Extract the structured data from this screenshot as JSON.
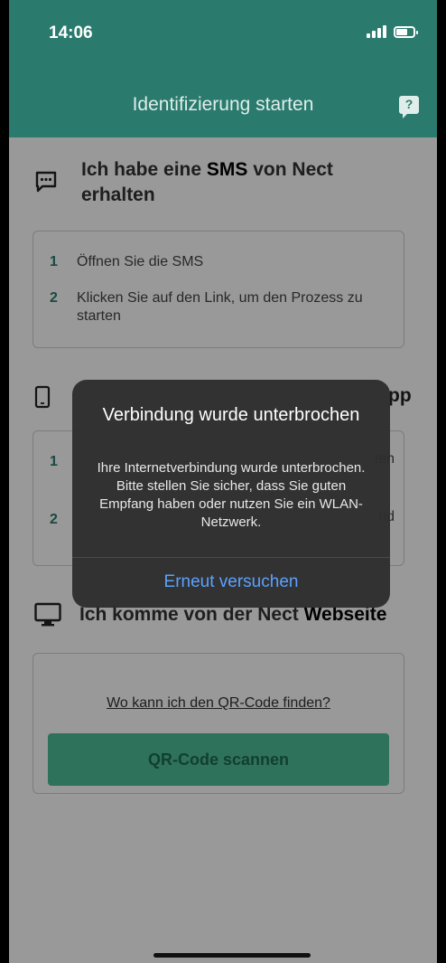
{
  "status_bar": {
    "time": "14:06"
  },
  "header": {
    "title": "Identifizierung starten",
    "help_label": "?"
  },
  "sms_section": {
    "title_prefix": "Ich habe eine ",
    "title_bold": "SMS",
    "title_suffix": " von Nect erhalten",
    "steps": [
      {
        "num": "1",
        "text": "Öffnen Sie die SMS"
      },
      {
        "num": "2",
        "text": "Klicken Sie auf den Link, um den Prozess zu starten"
      }
    ]
  },
  "app_section": {
    "title_end": "pp",
    "steps": [
      {
        "num": "1",
        "tail": "ten"
      },
      {
        "num": "2",
        "tail": "nd"
      }
    ]
  },
  "web_section": {
    "title_prefix": "Ich komme von der Nect ",
    "title_bold": "Webseite",
    "link": "Wo kann ich den QR-Code finden?",
    "button": "QR-Code scannen"
  },
  "alert": {
    "title": "Verbindung wurde unterbrochen",
    "message": "Ihre Internetverbindung wurde unterbrochen. Bitte stellen Sie sicher, dass Sie guten Empfang haben oder nutzen Sie ein WLAN-Netzwerk.",
    "button": "Erneut versuchen"
  },
  "colors": {
    "accent": "#2a7a6e",
    "button_green": "#4fbf9a",
    "alert_link": "#5aa2ff"
  }
}
